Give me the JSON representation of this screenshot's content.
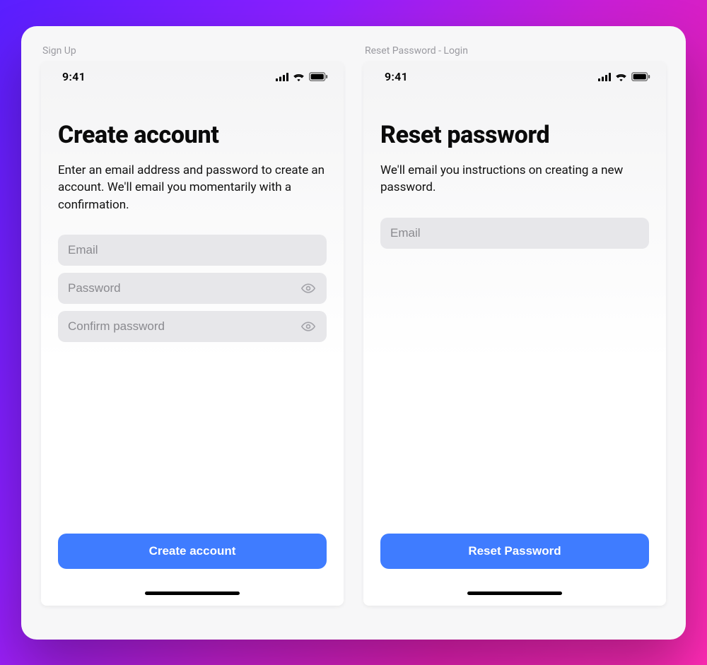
{
  "colors": {
    "primary_button": "#3f7cff",
    "field_bg": "#e7e7ea"
  },
  "statusbar": {
    "time": "9:41"
  },
  "left": {
    "label": "Sign Up",
    "title": "Create account",
    "subtitle": "Enter an email address and password to create an account. We'll email you momentarily with a confirmation.",
    "fields": {
      "email_placeholder": "Email",
      "password_placeholder": "Password",
      "confirm_placeholder": "Confirm password"
    },
    "cta": "Create account"
  },
  "right": {
    "label": "Reset Password - Login",
    "title": "Reset password",
    "subtitle": "We'll email you instructions on creating a new password.",
    "fields": {
      "email_placeholder": "Email"
    },
    "cta": "Reset Password"
  }
}
